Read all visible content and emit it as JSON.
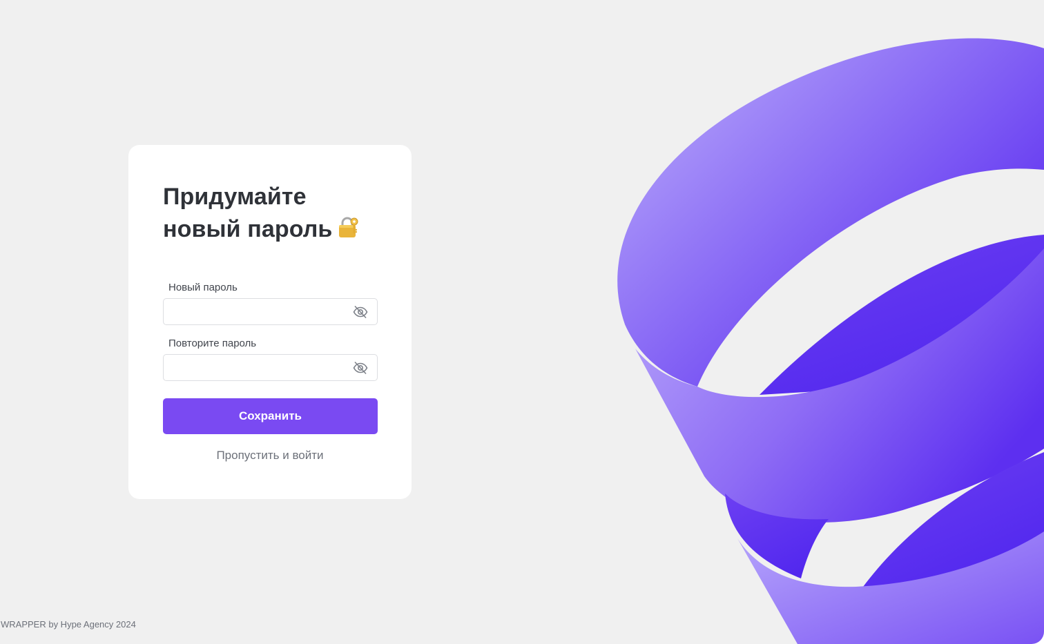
{
  "card": {
    "title_line1": "Придумайте",
    "title_line2": "новый пароль",
    "title_icon": "locked-with-key-icon",
    "new_password_label": "Новый пароль",
    "new_password_value": "",
    "repeat_password_label": "Повторите пароль",
    "repeat_password_value": "",
    "toggle_visibility_icon": "eye-slash-icon",
    "save_label": "Сохранить",
    "skip_label": "Пропустить и войти"
  },
  "footer": {
    "text": "WRAPPER by Hype Agency 2024"
  },
  "colors": {
    "background": "#f0f0f0",
    "card": "#ffffff",
    "accent": "#7a4af2",
    "ribbon_light": "#b3a2fa",
    "ribbon_dark": "#5a2bf0",
    "text_dark": "#2f3238",
    "text_muted": "#6c7079"
  }
}
